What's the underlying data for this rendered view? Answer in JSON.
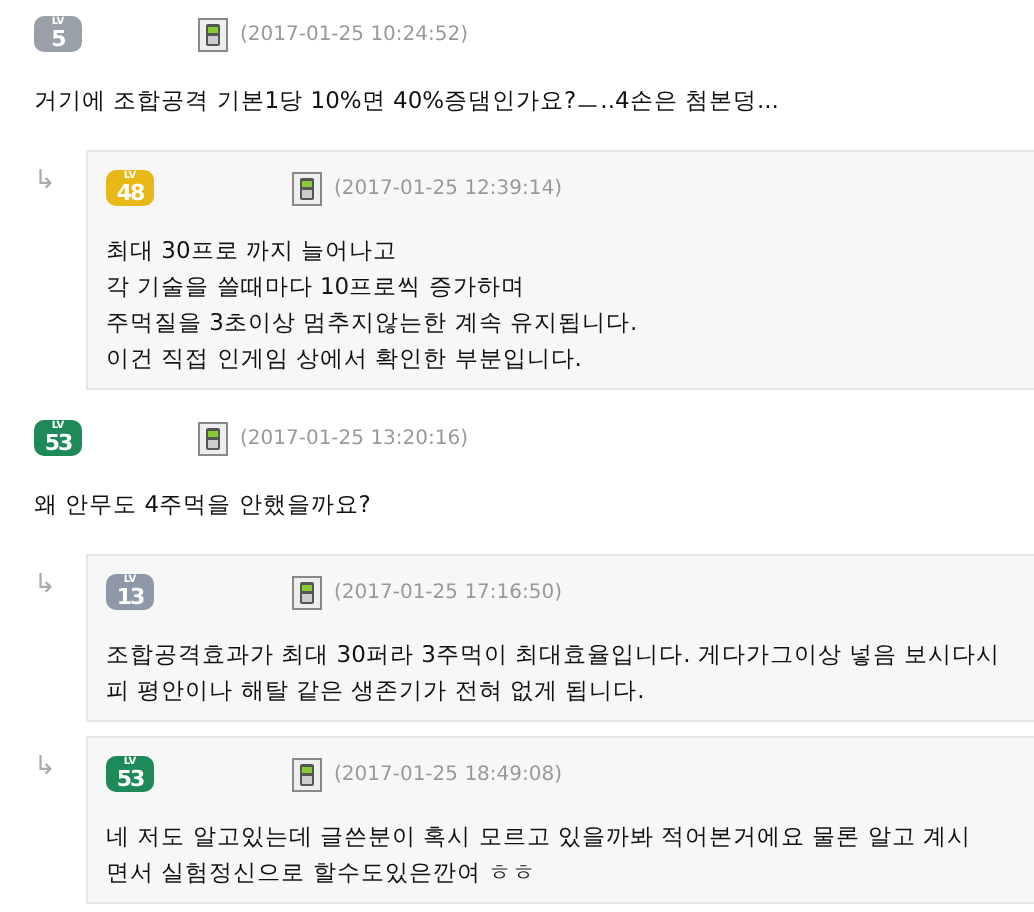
{
  "comments": [
    {
      "badge": {
        "label": "LV",
        "level": "5",
        "color": "#9aa0a8"
      },
      "timestamp": "(2017-01-25 10:24:52)",
      "lines": [
        "거기에 조합공격 기본1당 10%면 40%증댐인가요?ㅡ..4손은 첨본덩..."
      ],
      "children": [
        {
          "reply_mark": "↳",
          "badge": {
            "label": "LV",
            "level": "48",
            "color": "#e8b818"
          },
          "timestamp": "(2017-01-25 12:39:14)",
          "lines": [
            "최대 30프로 까지 늘어나고",
            "각 기술을 쓸때마다 10프로씩 증가하며",
            "주먹질을 3초이상 멈추지않는한 계속 유지됩니다.",
            "이건 직접 인게임 상에서 확인한 부분입니다."
          ]
        }
      ]
    },
    {
      "badge": {
        "label": "LV",
        "level": "53",
        "color": "#1e8a5a"
      },
      "timestamp": "(2017-01-25 13:20:16)",
      "lines": [
        "왜 안무도 4주먹을 안했을까요?"
      ],
      "children": [
        {
          "reply_mark": "↳",
          "badge": {
            "label": "LV",
            "level": "13",
            "color": "#8e98a8"
          },
          "timestamp": "(2017-01-25 17:16:50)",
          "lines": [
            "조합공격효과가 최대 30퍼라 3주먹이 최대효율입니다. 게다가그이상 넣음 보시다시",
            "피 평안이나 해탈 같은 생존기가 전혀 없게 됩니다."
          ]
        },
        {
          "reply_mark": "↳",
          "badge": {
            "label": "LV",
            "level": "53",
            "color": "#1e8a5a"
          },
          "timestamp": "(2017-01-25 18:49:08)",
          "lines": [
            "네 저도 알고있는데 글쓴분이 혹시 모르고 있을까봐 적어본거에요 물론 알고 계시",
            "면서 실험정신으로 할수도있은깐여 ㅎㅎ"
          ]
        }
      ]
    }
  ]
}
